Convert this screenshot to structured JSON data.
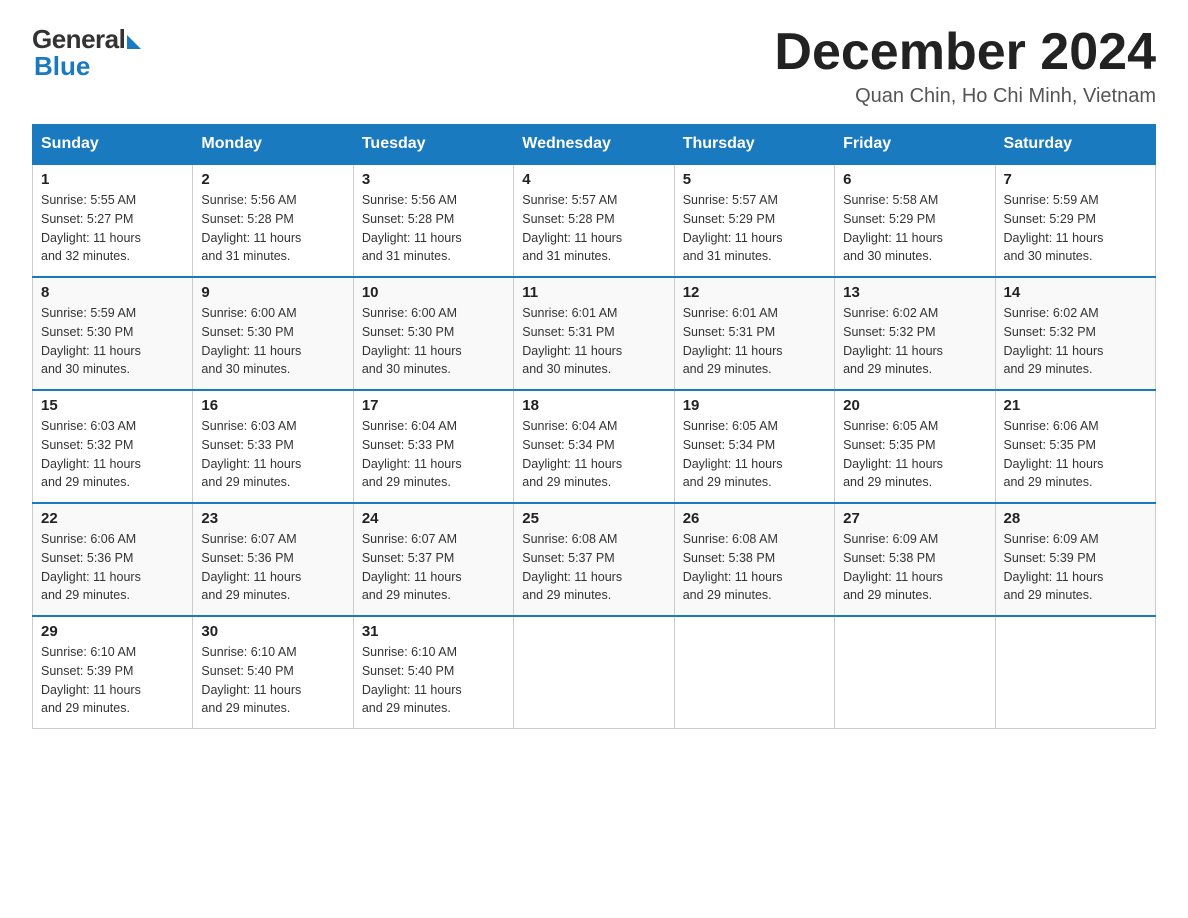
{
  "logo": {
    "general": "General",
    "blue": "Blue"
  },
  "title": "December 2024",
  "location": "Quan Chin, Ho Chi Minh, Vietnam",
  "days_of_week": [
    "Sunday",
    "Monday",
    "Tuesday",
    "Wednesday",
    "Thursday",
    "Friday",
    "Saturday"
  ],
  "weeks": [
    [
      {
        "day": "1",
        "sunrise": "5:55 AM",
        "sunset": "5:27 PM",
        "daylight": "11 hours and 32 minutes."
      },
      {
        "day": "2",
        "sunrise": "5:56 AM",
        "sunset": "5:28 PM",
        "daylight": "11 hours and 31 minutes."
      },
      {
        "day": "3",
        "sunrise": "5:56 AM",
        "sunset": "5:28 PM",
        "daylight": "11 hours and 31 minutes."
      },
      {
        "day": "4",
        "sunrise": "5:57 AM",
        "sunset": "5:28 PM",
        "daylight": "11 hours and 31 minutes."
      },
      {
        "day": "5",
        "sunrise": "5:57 AM",
        "sunset": "5:29 PM",
        "daylight": "11 hours and 31 minutes."
      },
      {
        "day": "6",
        "sunrise": "5:58 AM",
        "sunset": "5:29 PM",
        "daylight": "11 hours and 30 minutes."
      },
      {
        "day": "7",
        "sunrise": "5:59 AM",
        "sunset": "5:29 PM",
        "daylight": "11 hours and 30 minutes."
      }
    ],
    [
      {
        "day": "8",
        "sunrise": "5:59 AM",
        "sunset": "5:30 PM",
        "daylight": "11 hours and 30 minutes."
      },
      {
        "day": "9",
        "sunrise": "6:00 AM",
        "sunset": "5:30 PM",
        "daylight": "11 hours and 30 minutes."
      },
      {
        "day": "10",
        "sunrise": "6:00 AM",
        "sunset": "5:30 PM",
        "daylight": "11 hours and 30 minutes."
      },
      {
        "day": "11",
        "sunrise": "6:01 AM",
        "sunset": "5:31 PM",
        "daylight": "11 hours and 30 minutes."
      },
      {
        "day": "12",
        "sunrise": "6:01 AM",
        "sunset": "5:31 PM",
        "daylight": "11 hours and 29 minutes."
      },
      {
        "day": "13",
        "sunrise": "6:02 AM",
        "sunset": "5:32 PM",
        "daylight": "11 hours and 29 minutes."
      },
      {
        "day": "14",
        "sunrise": "6:02 AM",
        "sunset": "5:32 PM",
        "daylight": "11 hours and 29 minutes."
      }
    ],
    [
      {
        "day": "15",
        "sunrise": "6:03 AM",
        "sunset": "5:32 PM",
        "daylight": "11 hours and 29 minutes."
      },
      {
        "day": "16",
        "sunrise": "6:03 AM",
        "sunset": "5:33 PM",
        "daylight": "11 hours and 29 minutes."
      },
      {
        "day": "17",
        "sunrise": "6:04 AM",
        "sunset": "5:33 PM",
        "daylight": "11 hours and 29 minutes."
      },
      {
        "day": "18",
        "sunrise": "6:04 AM",
        "sunset": "5:34 PM",
        "daylight": "11 hours and 29 minutes."
      },
      {
        "day": "19",
        "sunrise": "6:05 AM",
        "sunset": "5:34 PM",
        "daylight": "11 hours and 29 minutes."
      },
      {
        "day": "20",
        "sunrise": "6:05 AM",
        "sunset": "5:35 PM",
        "daylight": "11 hours and 29 minutes."
      },
      {
        "day": "21",
        "sunrise": "6:06 AM",
        "sunset": "5:35 PM",
        "daylight": "11 hours and 29 minutes."
      }
    ],
    [
      {
        "day": "22",
        "sunrise": "6:06 AM",
        "sunset": "5:36 PM",
        "daylight": "11 hours and 29 minutes."
      },
      {
        "day": "23",
        "sunrise": "6:07 AM",
        "sunset": "5:36 PM",
        "daylight": "11 hours and 29 minutes."
      },
      {
        "day": "24",
        "sunrise": "6:07 AM",
        "sunset": "5:37 PM",
        "daylight": "11 hours and 29 minutes."
      },
      {
        "day": "25",
        "sunrise": "6:08 AM",
        "sunset": "5:37 PM",
        "daylight": "11 hours and 29 minutes."
      },
      {
        "day": "26",
        "sunrise": "6:08 AM",
        "sunset": "5:38 PM",
        "daylight": "11 hours and 29 minutes."
      },
      {
        "day": "27",
        "sunrise": "6:09 AM",
        "sunset": "5:38 PM",
        "daylight": "11 hours and 29 minutes."
      },
      {
        "day": "28",
        "sunrise": "6:09 AM",
        "sunset": "5:39 PM",
        "daylight": "11 hours and 29 minutes."
      }
    ],
    [
      {
        "day": "29",
        "sunrise": "6:10 AM",
        "sunset": "5:39 PM",
        "daylight": "11 hours and 29 minutes."
      },
      {
        "day": "30",
        "sunrise": "6:10 AM",
        "sunset": "5:40 PM",
        "daylight": "11 hours and 29 minutes."
      },
      {
        "day": "31",
        "sunrise": "6:10 AM",
        "sunset": "5:40 PM",
        "daylight": "11 hours and 29 minutes."
      },
      null,
      null,
      null,
      null
    ]
  ]
}
